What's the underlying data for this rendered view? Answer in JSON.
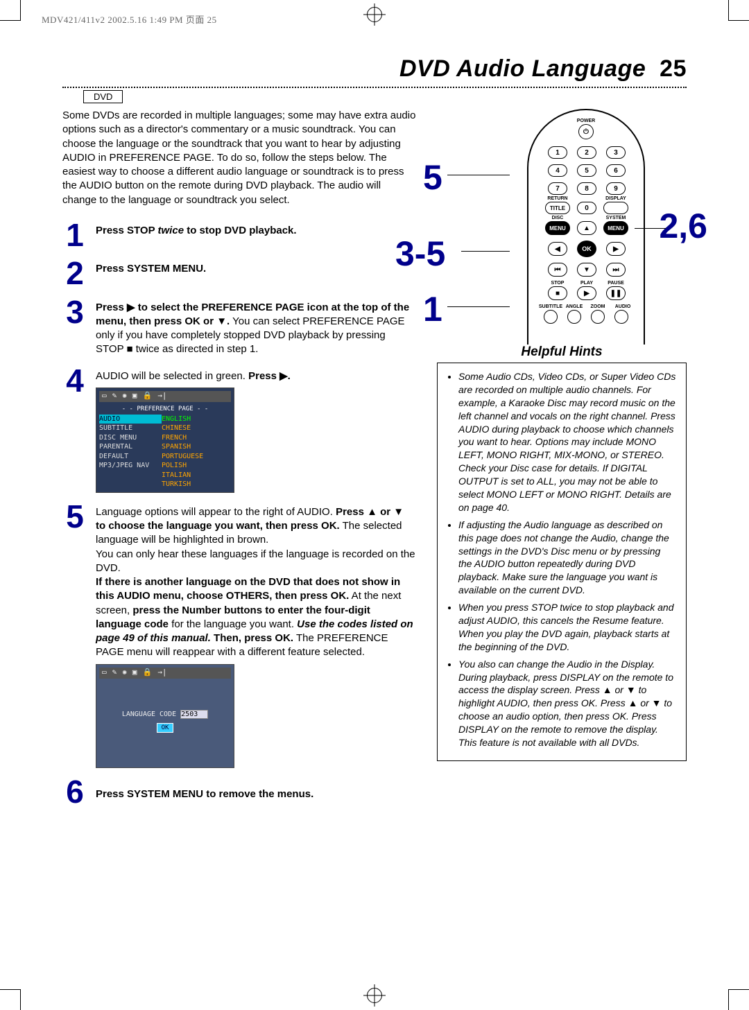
{
  "print_header": "MDV421/411v2  2002.5.16  1:49 PM  页面 25",
  "title": "DVD Audio Language",
  "page_number": "25",
  "dvd_label": "DVD",
  "intro": "Some DVDs are recorded in multiple languages; some may have extra audio options such as a director's commentary or a music soundtrack. You can choose the language or the soundtrack that you want to hear by adjusting AUDIO in PREFERENCE PAGE.  To do so, follow the steps below. The easiest way to choose a different audio language or soundtrack is to press the AUDIO button on the remote during DVD playback. The audio will change to the language or soundtrack you select.",
  "steps": {
    "s1": {
      "num": "1",
      "b1": "Press STOP ",
      "i1": "twice",
      "t1": " to stop DVD playback."
    },
    "s2": {
      "num": "2",
      "b1": "Press SYSTEM MENU."
    },
    "s3": {
      "num": "3",
      "b1": "Press ▶ to select the PREFERENCE PAGE icon at the top of the menu, then press OK or ▼.",
      "t1": " You can select PREFERENCE PAGE only if you have completely stopped DVD playback by pressing STOP ■ twice as directed in step 1."
    },
    "s4": {
      "num": "4",
      "t1": "AUDIO will be selected in green. ",
      "b1": "Press ▶."
    },
    "s5": {
      "num": "5",
      "t1": "Language options will appear to the right of AUDIO. ",
      "b1": "Press ▲ or ▼ to choose the language you want, then press OK.",
      "t2": " The selected language will be highlighted in brown.",
      "t3": "You can only hear these languages if the language is recorded on the DVD.",
      "b2": "If there is another language on the DVD that does not show in this AUDIO menu, choose OTHERS, then press OK.",
      "t4": " At the next screen, ",
      "b3": "press the Number buttons to enter the four-digit language code",
      "t5": " for the language you want. ",
      "i1": "Use the codes listed on page 49 of this manual.",
      "b4": " Then, press OK.",
      "t6": " The PREFERENCE PAGE menu will reappear with a different feature selected."
    },
    "s6": {
      "num": "6",
      "b1": "Press SYSTEM MENU to remove the menus."
    }
  },
  "osd1": {
    "header": "- -  PREFERENCE  PAGE  - -",
    "rows": [
      {
        "l": "AUDIO",
        "r": "ENGLISH"
      },
      {
        "l": "SUBTITLE",
        "r": "CHINESE"
      },
      {
        "l": "DISC MENU",
        "r": "FRENCH"
      },
      {
        "l": "PARENTAL",
        "r": "SPANISH"
      },
      {
        "l": "DEFAULT",
        "r": "PORTUGUESE"
      },
      {
        "l": "MP3/JPEG NAV",
        "r": "POLISH"
      },
      {
        "l": "",
        "r": "ITALIAN"
      },
      {
        "l": "",
        "r": "TURKISH"
      }
    ]
  },
  "osd2": {
    "code_label": "LANGUAGE CODE",
    "code_value": "2503",
    "ok": "OK"
  },
  "remote": {
    "power": "POWER",
    "return": "RETURN",
    "display": "DISPLAY",
    "title": "TITLE",
    "disc": "DISC",
    "system": "SYSTEM",
    "menu_l": "MENU",
    "menu_r": "MENU",
    "ok": "OK",
    "stop": "STOP",
    "play": "PLAY",
    "pause": "PAUSE",
    "subtitle": "SUBTITLE",
    "angle": "ANGLE",
    "zoom": "ZOOM",
    "audio": "AUDIO",
    "nums": [
      "1",
      "2",
      "3",
      "4",
      "5",
      "6",
      "7",
      "8",
      "9",
      "0"
    ]
  },
  "callouts": {
    "c5": "5",
    "c35": "3-5",
    "c26": "2,6",
    "c1": "1"
  },
  "hints": {
    "title": "Helpful Hints",
    "items": [
      "Some Audio CDs, Video CDs, or Super Video CDs are recorded on multiple audio channels. For example, a Karaoke Disc may record music on the left channel and vocals on the right channel. Press AUDIO during playback to choose which channels you want to hear. Options may include MONO LEFT, MONO RIGHT, MIX-MONO, or STEREO. Check your Disc case for details. If DIGITAL OUTPUT is set to ALL, you may not be able to select MONO LEFT or MONO RIGHT. Details are on page 40.",
      "If adjusting the Audio language as described on this page does not change the Audio, change the settings in the DVD's Disc menu or by pressing the AUDIO button repeatedly during DVD playback. Make sure the language you want is available on the current DVD.",
      "When you press STOP twice to stop playback and adjust AUDIO, this cancels the Resume feature. When you play the DVD again, playback starts at the beginning of the DVD.",
      "You also can change the Audio in the Display. During playback, press DISPLAY on the remote to access the display screen. Press ▲ or ▼  to highlight AUDIO, then press OK. Press ▲ or ▼ to choose an audio option, then press OK. Press DISPLAY on the remote to remove the display.  This feature is not available with all DVDs."
    ]
  }
}
